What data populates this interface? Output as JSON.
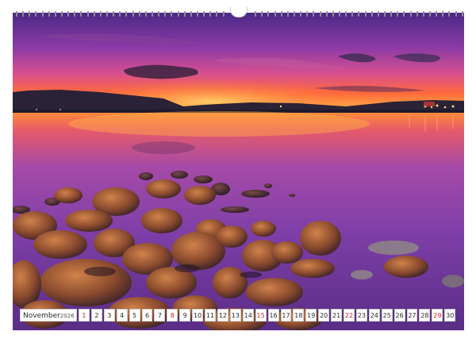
{
  "calendar": {
    "month": "November",
    "year": "2026",
    "days": [
      {
        "n": "1",
        "sun": true
      },
      {
        "n": "2"
      },
      {
        "n": "3"
      },
      {
        "n": "4"
      },
      {
        "n": "5"
      },
      {
        "n": "6"
      },
      {
        "n": "7"
      },
      {
        "n": "8",
        "sun": true
      },
      {
        "n": "9"
      },
      {
        "n": "10"
      },
      {
        "n": "11"
      },
      {
        "n": "12"
      },
      {
        "n": "13"
      },
      {
        "n": "14"
      },
      {
        "n": "15",
        "sun": true
      },
      {
        "n": "16"
      },
      {
        "n": "17"
      },
      {
        "n": "18"
      },
      {
        "n": "19"
      },
      {
        "n": "20"
      },
      {
        "n": "21"
      },
      {
        "n": "22",
        "sun": true
      },
      {
        "n": "23"
      },
      {
        "n": "24"
      },
      {
        "n": "25"
      },
      {
        "n": "26"
      },
      {
        "n": "27"
      },
      {
        "n": "28"
      },
      {
        "n": "29",
        "sun": true
      },
      {
        "n": "30"
      }
    ]
  },
  "colors": {
    "sunday": "#d22020",
    "sky_top": "#5a2a8c",
    "sky_glow": "#ff7a2a",
    "water": "#7d3fa6"
  }
}
